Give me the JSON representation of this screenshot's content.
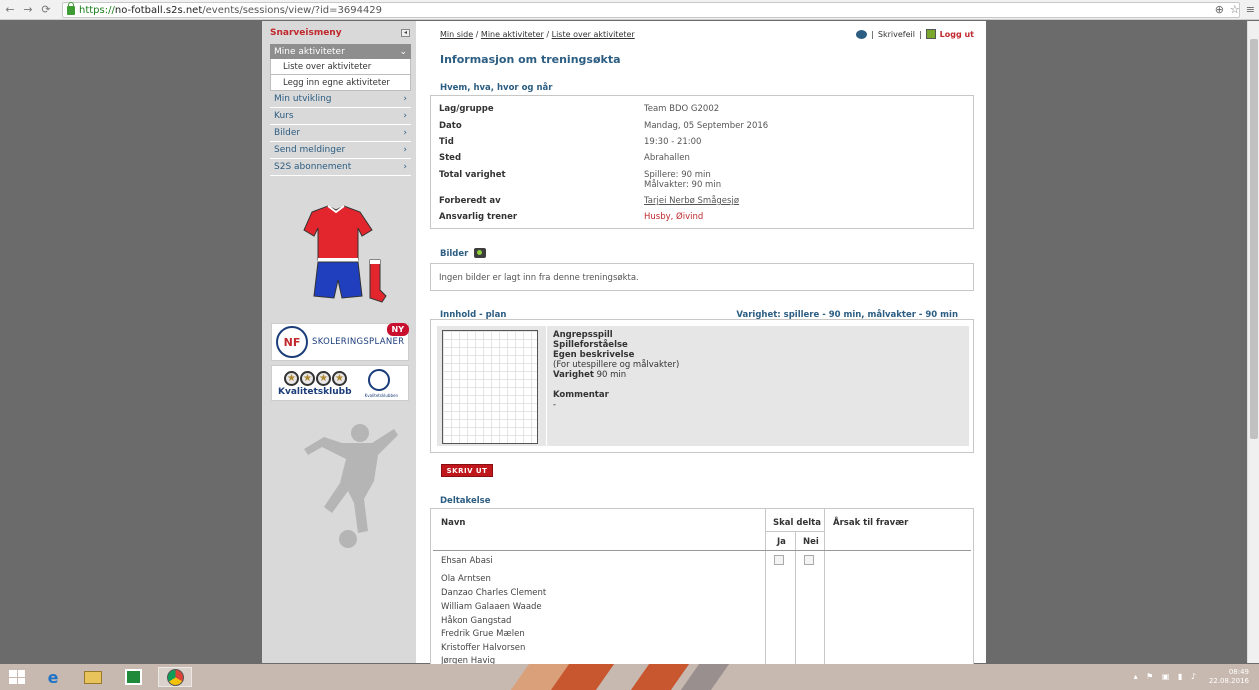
{
  "browser": {
    "url_scheme": "https://",
    "url_host": "no-fotball.s2s.net",
    "url_path": "/events/sessions/view/?id=3694429",
    "back_icon": "back-arrow-icon",
    "forward_icon": "forward-arrow-icon",
    "reload_icon": "reload-icon"
  },
  "sidebar": {
    "title": "Snarveismeny",
    "section_head": "Mine aktiviteter",
    "sub_items": [
      "Liste over aktiviteter",
      "Legg inn egne aktiviteter"
    ],
    "items": [
      "Min utvikling",
      "Kurs",
      "Bilder",
      "Send meldinger",
      "S2S abonnement"
    ],
    "nff_text": "SKOLERINGSPLANER",
    "ny_badge": "NY",
    "kval_text": "Kvalitetsklubb",
    "kval_sub": "Kvalitetsklubben"
  },
  "header": {
    "crumb_1": "Min side",
    "crumb_2": "Mine aktiviteter",
    "crumb_3": "Liste over aktiviteter",
    "sep": " / ",
    "skrivefeil": "Skrivefeil",
    "logout": "Logg ut",
    "divider": "|"
  },
  "title": "Informasjon om treningsøkta",
  "info": {
    "section": "Hvem, hva, hvor og når",
    "rows": [
      {
        "label": "Lag/gruppe",
        "value": "Team BDO G2002"
      },
      {
        "label": "Dato",
        "value": "Mandag, 05 September 2016"
      },
      {
        "label": "Tid",
        "value": "19:30 - 21:00"
      },
      {
        "label": "Sted",
        "value": "Abrahallen"
      },
      {
        "label": "Total varighet",
        "value": "Spillere: 90 min",
        "value2": "Målvakter: 90 min"
      },
      {
        "label": "Forberedt av",
        "value": "Tarjei Nerbø Smågesjø"
      },
      {
        "label": "Ansvarlig trener",
        "value": "Husby, Øivind"
      }
    ]
  },
  "bilder": {
    "section": "Bilder",
    "empty": "Ingen bilder er lagt inn fra denne treningsøkta."
  },
  "plan": {
    "section": "Innhold - plan",
    "duration": "Varighet: spillere - 90 min, målvakter - 90 min",
    "line1": "Angrepsspill",
    "line2": "Spilleforståelse",
    "line3": "Egen beskrivelse",
    "line4": "(For utespillere og målvakter)",
    "varighet_label": "Varighet",
    "varighet_value": " 90 min",
    "kommentar_label": "Kommentar",
    "kommentar_value": "-"
  },
  "print_button": "SKRIV UT",
  "deltakelse": {
    "section": "Deltakelse",
    "col_navn": "Navn",
    "col_skal": "Skal delta",
    "col_ja": "Ja",
    "col_nei": "Nei",
    "col_arsak": "Årsak til fravær",
    "names": [
      "Ehsan Abasi",
      "Ola Arntsen",
      "Danzao Charles Clement",
      "William Galaaen Waade",
      "Håkon Gangstad",
      "Fredrik Grue Mælen",
      "Kristoffer Halvorsen",
      "Jørgen Havig"
    ]
  },
  "taskbar": {
    "time": "08:49",
    "date": "22.08.2016"
  }
}
